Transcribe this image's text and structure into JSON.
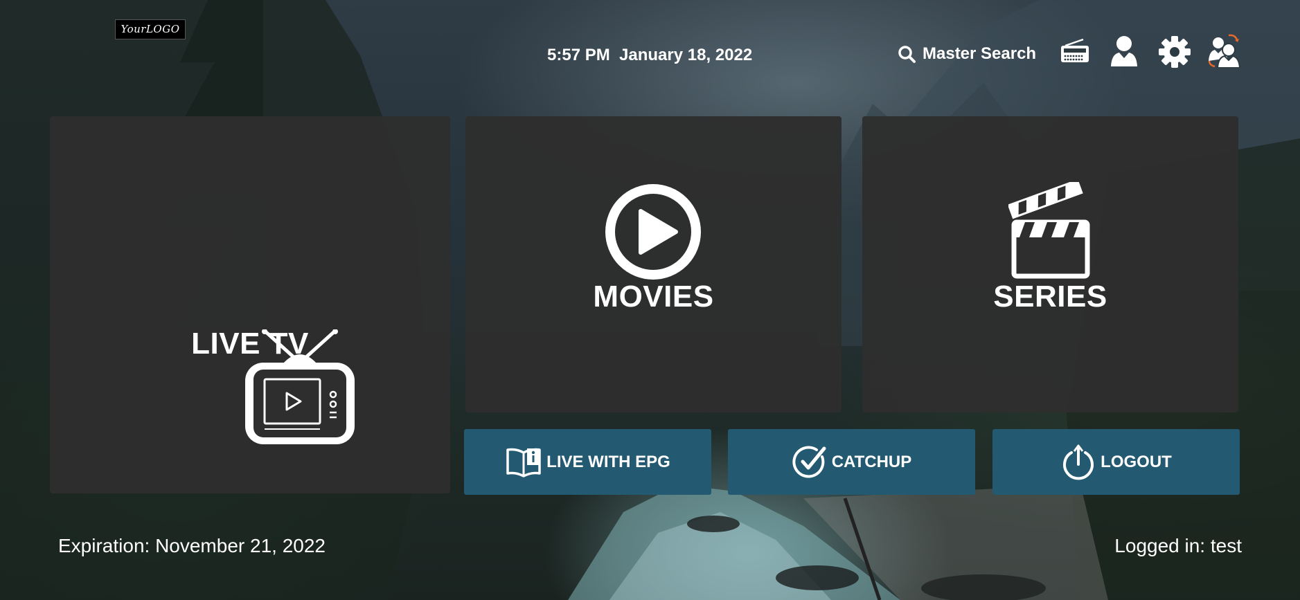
{
  "header": {
    "logo_text": "YourLOGO",
    "datetime": "5:57 PM  January 18, 2022",
    "search_label": "Master Search",
    "icons": [
      "search-icon",
      "radio-icon",
      "user-icon",
      "gear-icon",
      "switch-user-icon"
    ]
  },
  "tiles": {
    "live_tv": {
      "label": "LIVE TV",
      "icon": "tv-icon"
    },
    "movies": {
      "label": "MOVIES",
      "icon": "play-circle-icon"
    },
    "series": {
      "label": "SERIES",
      "icon": "clapperboard-icon"
    }
  },
  "actions": {
    "live_epg": {
      "label": "LIVE WITH EPG",
      "icon": "guide-book-icon"
    },
    "catchup": {
      "label": "CATCHUP",
      "icon": "check-circle-icon"
    },
    "logout": {
      "label": "LOGOUT",
      "icon": "power-icon"
    }
  },
  "footer": {
    "expiration": "Expiration: November 21, 2022",
    "logged_in": "Logged in: test"
  },
  "colors": {
    "tile_bg": "#2e2e2e",
    "action_bg": "#235a72",
    "accent_orange": "#e8692c"
  }
}
